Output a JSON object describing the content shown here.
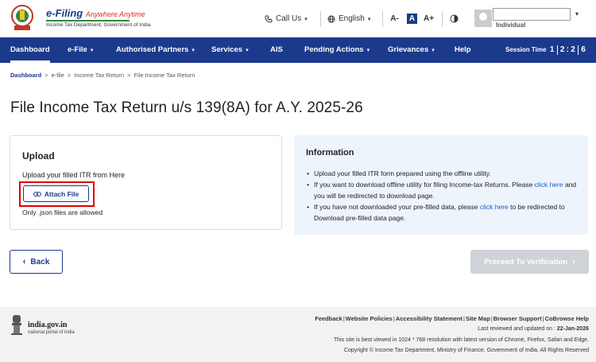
{
  "header": {
    "brand_title": "e-Filing",
    "brand_tagline": "Anywhere Anytime",
    "brand_subtitle": "Income Tax Department, Government of India",
    "call_us": "Call Us",
    "language": "English",
    "font_decrease": "A-",
    "font_normal": "A",
    "font_increase": "A+",
    "user_role": "Individual"
  },
  "nav": {
    "items": [
      "Dashboard",
      "e-File",
      "Authorised Partners",
      "Services",
      "AIS",
      "Pending Actions",
      "Grievances",
      "Help"
    ],
    "session_label": "Session Time",
    "session_digits": [
      "1",
      "2",
      "2",
      "6"
    ]
  },
  "breadcrumb": [
    "Dashboard",
    "e-file",
    "Income Tax Return",
    "File Income Tax Return"
  ],
  "page_title": "File Income Tax Return u/s 139(8A) for A.Y. 2025-26",
  "upload": {
    "heading": "Upload",
    "instruction": "Upload your filled ITR from Here",
    "attach_label": "Attach File",
    "note": "Only .json files are allowed"
  },
  "info": {
    "heading": "Information",
    "item1": "Upload your filled ITR form prepared using the offline utility.",
    "item2_a": "If you want to download offline utility for filing Income-tax Returns. Please",
    "item2_link": "click here",
    "item2_b": "and you will be redirected to download page.",
    "item3_a": "If you have not downloaded your pre-filled data, please",
    "item3_link": "click here",
    "item3_b": "to be redirected to Download pre-filled data page."
  },
  "actions": {
    "back_label": "Back",
    "proceed_label": "Proceed To Verification"
  },
  "footer": {
    "portal_name": "india.gov.in",
    "portal_sub": "national portal of india",
    "links": [
      "Feedback",
      "Website Policies",
      "Accessibility Statement",
      "Site Map",
      "Browser Support",
      "CoBrowse Help"
    ],
    "updated_label": "Last reviewed and updated on :",
    "updated_date": "22-Jan-2026",
    "best_viewed": "This site is best viewed in 1024 * 768 resolution with latest version of Chrome, Firefox, Safari and Edge.",
    "copyright": "Copyright © Income Tax Department, Ministry of Finance, Government of India. All Rights Reserved"
  },
  "colors": {
    "primary": "#1c3a8c",
    "highlight": "#e00000",
    "link": "#1c5dc9",
    "disabled": "#cfd2d6"
  }
}
